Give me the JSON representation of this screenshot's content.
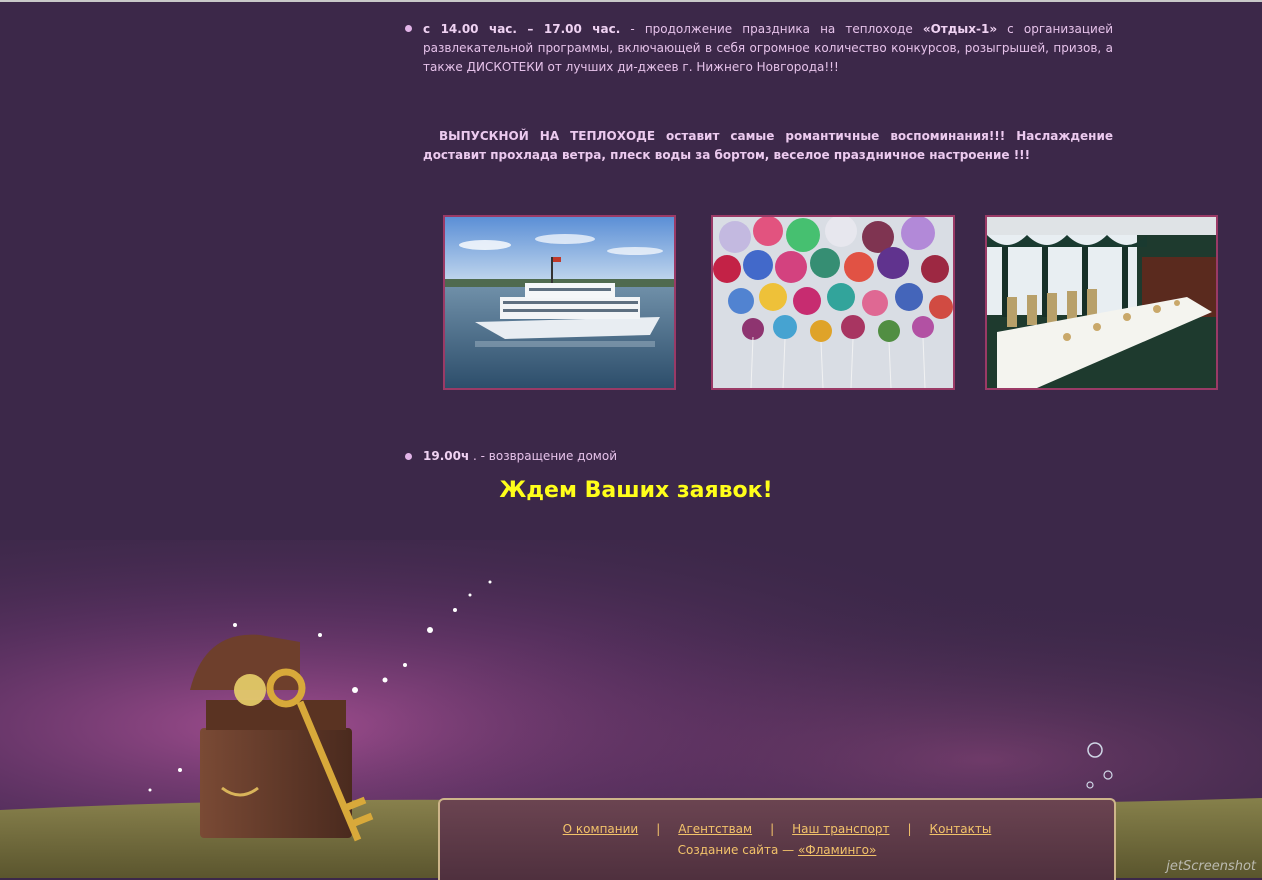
{
  "program": {
    "item1": {
      "time": "с 14.00 час. – 17.00 час.",
      "text_a": " - продолжение праздника на теплоходе ",
      "ship_name": "«Отдых-1»",
      "text_b": " с организацией развлекательной программы, включающей в себя огромное количество конкурсов, розыгрышей, призов, а также ДИСКОТЕКИ от лучших ди-джеев г. Нижнего Новгорода!!!"
    },
    "highlight": "ВЫПУСКНОЙ НА ТЕПЛОХОДЕ оставит самые романтичные воспоминания!!! Наслаждение доставит прохлада ветра, плеск воды за бортом, веселое праздничное настроение !!!",
    "item2": {
      "time": "19.00ч",
      "text": " . - возвращение домой"
    }
  },
  "call_to_action": "Ждем Ваших заявок!",
  "photos": [
    {
      "subject": "riverboat",
      "alt": ""
    },
    {
      "subject": "balloons",
      "alt": ""
    },
    {
      "subject": "banquet-hall",
      "alt": ""
    }
  ],
  "footer": {
    "links": [
      "О компании",
      "Агентствам",
      "Наш транспорт",
      "Контакты"
    ],
    "separator": "|",
    "credit_prefix": "Создание сайта — ",
    "credit_link": "«Фламинго»"
  },
  "watermark": "jetScreenshot",
  "colors": {
    "background": "#3c2849",
    "accent_yellow": "#ffff1a",
    "photo_border": "#9a3a66",
    "footer_link": "#f2c26a"
  }
}
